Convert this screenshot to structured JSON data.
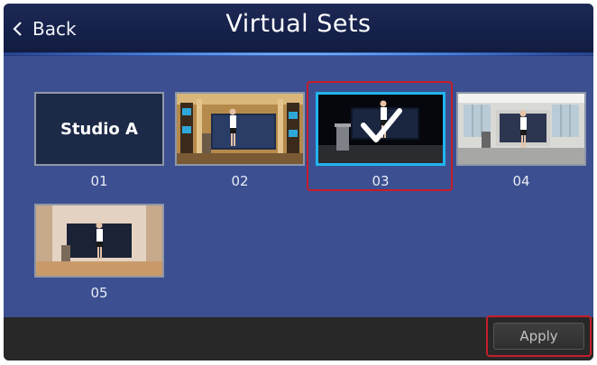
{
  "header": {
    "back_label": "Back",
    "title": "Virtual Sets"
  },
  "sets": [
    {
      "label": "01",
      "preview_text": "Studio A",
      "selected": false
    },
    {
      "label": "02",
      "selected": false
    },
    {
      "label": "03",
      "selected": true
    },
    {
      "label": "04",
      "selected": false
    },
    {
      "label": "05",
      "selected": false
    }
  ],
  "footer": {
    "apply_label": "Apply"
  },
  "colors": {
    "header_bg": "#1a2650",
    "main_bg": "#3c4f90",
    "footer_bg": "#282828",
    "selection_border": "#22b4ee",
    "highlight_outline": "#c51d2a"
  },
  "icons": {
    "back": "chevron-left-icon",
    "selected": "checkmark-icon"
  }
}
